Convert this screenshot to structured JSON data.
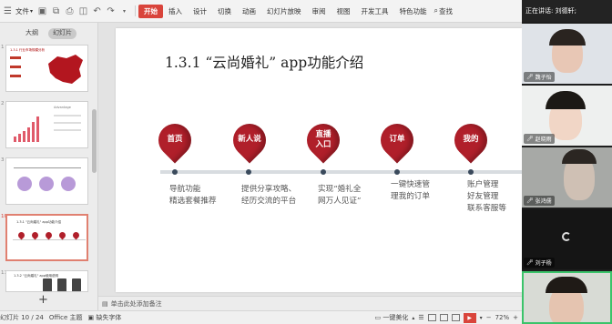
{
  "menubar": {
    "file_label": "文件",
    "tabs": [
      "开始",
      "插入",
      "设计",
      "切换",
      "动画",
      "幻灯片放映",
      "审阅",
      "视图",
      "开发工具",
      "特色功能"
    ],
    "active_tab": "开始",
    "search_label": "查找"
  },
  "panel": {
    "tabs": [
      "大纲",
      "幻灯片"
    ],
    "active": "幻灯片",
    "thumbs": [
      {
        "num": "1",
        "caption": "1.3.1 行业市场规模分析"
      },
      {
        "num": "2",
        "caption": "Advantage"
      },
      {
        "num": "3",
        "caption": ""
      },
      {
        "num": "10",
        "caption": "1.3.1 \"云尚婚礼\" app功能介绍"
      },
      {
        "num": "11",
        "caption": "1.3.2 \"云尚婚礼\" app使用说明"
      }
    ]
  },
  "slide": {
    "title": "1.3.1 “云尚婚礼” app功能介绍",
    "milestones": [
      {
        "label": "首页",
        "label2": "",
        "desc1": "导航功能",
        "desc2": "精选套餐推荐",
        "desc3": ""
      },
      {
        "label": "新人说",
        "label2": "",
        "desc1": "提供分享攻略、",
        "desc2": "经历交流的平台",
        "desc3": ""
      },
      {
        "label": "直播",
        "label2": "入口",
        "desc1": "实现“婚礼全",
        "desc2": "网万人见证”",
        "desc3": ""
      },
      {
        "label": "订单",
        "label2": "",
        "desc1": "一键快速管",
        "desc2": "理我的订单",
        "desc3": ""
      },
      {
        "label": "我的",
        "label2": "",
        "desc1": "账户管理",
        "desc2": "好友管理",
        "desc3": "联系客服等"
      }
    ]
  },
  "notes": {
    "placeholder": "单击此处添加备注"
  },
  "statusbar": {
    "slide_pos": "幻灯片 10 / 24",
    "theme": "Office 主题",
    "missing_font": "缺失字体",
    "beautify": "一键美化",
    "zoom": "72%"
  },
  "meeting": {
    "speaking": "正在讲话: 刘德轩;",
    "participants": [
      {
        "name": "魏子怡"
      },
      {
        "name": "赵晓雨"
      },
      {
        "name": "张鸿儒"
      },
      {
        "name": "刘子杨"
      },
      {
        "name": ""
      }
    ]
  },
  "colors": {
    "accent": "#d9443b",
    "pin": "#b01f2a",
    "meeting_bg": "#1d1d1d"
  }
}
